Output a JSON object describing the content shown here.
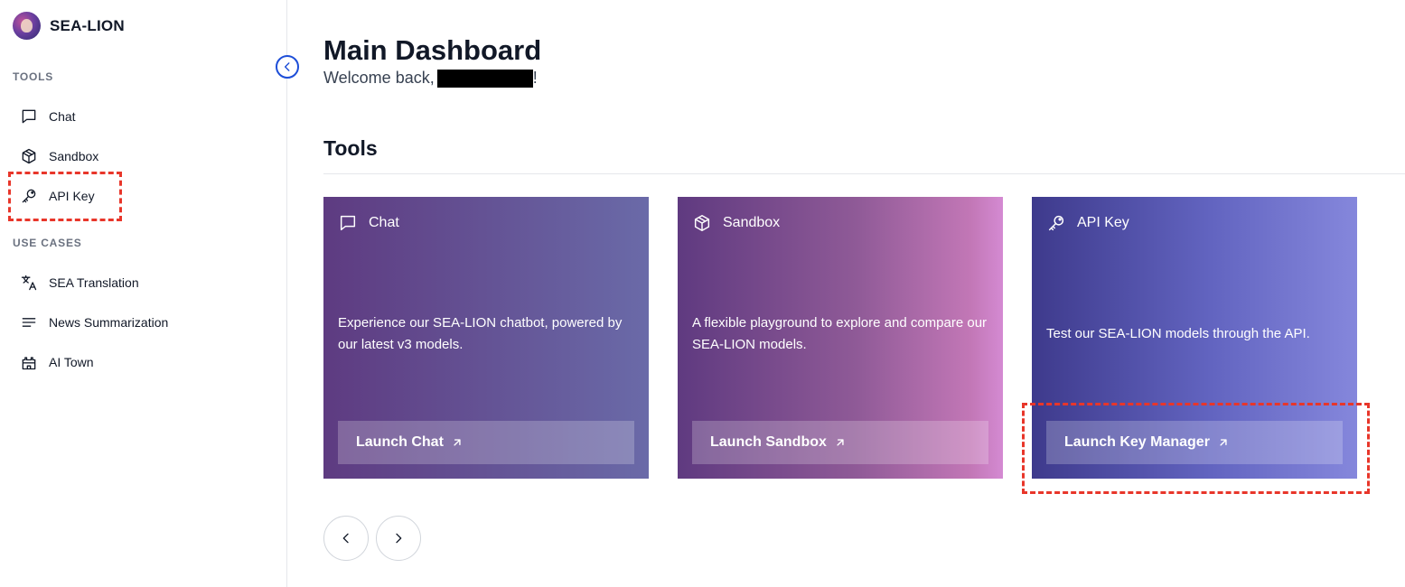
{
  "app": {
    "name": "SEA-LION"
  },
  "sidebar": {
    "tools_label": "TOOLS",
    "tools": [
      {
        "label": "Chat",
        "icon": "chat-icon"
      },
      {
        "label": "Sandbox",
        "icon": "cube-icon"
      },
      {
        "label": "API Key",
        "icon": "key-icon"
      }
    ],
    "use_cases_label": "USE CASES",
    "use_cases": [
      {
        "label": "SEA Translation",
        "icon": "translate-icon"
      },
      {
        "label": "News Summarization",
        "icon": "lines-icon"
      },
      {
        "label": "AI Town",
        "icon": "castle-icon"
      }
    ]
  },
  "main": {
    "title": "Main Dashboard",
    "welcome_prefix": "Welcome back,",
    "welcome_suffix": "!",
    "section_title": "Tools",
    "cards": [
      {
        "title": "Chat",
        "icon": "chat-icon",
        "description": "Experience our SEA-LION chatbot, powered by our latest v3 models.",
        "button": "Launch Chat"
      },
      {
        "title": "Sandbox",
        "icon": "cube-icon",
        "description": "A flexible playground to explore and compare our SEA-LION models.",
        "button": "Launch Sandbox"
      },
      {
        "title": "API Key",
        "icon": "key-icon",
        "description": "Test our SEA-LION models through the API.",
        "button": "Launch Key Manager"
      }
    ]
  },
  "colors": {
    "highlight": "#e8362a",
    "collapse_accent": "#1d4ed8",
    "chat_card": [
      "#5e3b81",
      "#6a6aa8"
    ],
    "sandbox_card": [
      "#5f3a80",
      "#d48ad2"
    ],
    "api_card": [
      "#3e3a8c",
      "#8587dc"
    ]
  }
}
